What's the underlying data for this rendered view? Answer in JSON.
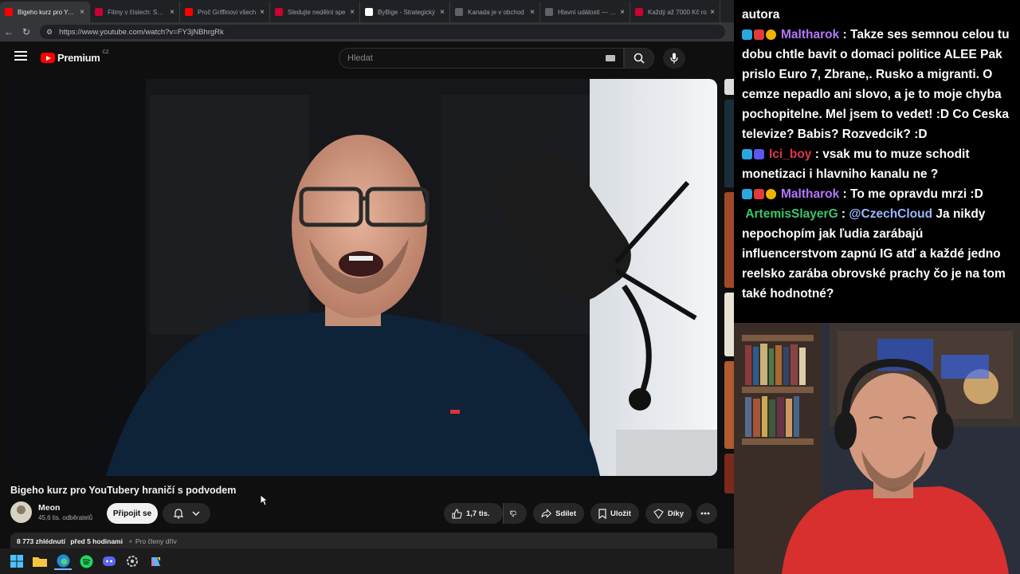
{
  "browser": {
    "tabs": [
      {
        "title": "Bigeho kurz pro YouT",
        "fav": "#ff0000",
        "active": true
      },
      {
        "title": "Filmy v číslech: SPIDE",
        "fav": "#cc0033",
        "active": false
      },
      {
        "title": "Proč Griffinovi všech",
        "fav": "#ff0000",
        "active": false
      },
      {
        "title": "Sledujte nedělní spe",
        "fav": "#cc0033",
        "active": false
      },
      {
        "title": "ByBige - Strategický",
        "fav": "#ffffff",
        "active": false
      },
      {
        "title": "Kanada je v obchod",
        "fav": "#5f6368",
        "active": false
      },
      {
        "title": "Hlavní události — ČT",
        "fav": "#5f6368",
        "active": false
      },
      {
        "title": "Každý až 7000 Kč ro",
        "fav": "#cc0033",
        "active": false
      }
    ],
    "url": "https://www.youtube.com/watch?v=FY3jNBhrgRk"
  },
  "youtube": {
    "logo_text": "Premium",
    "country": "CZ",
    "search_placeholder": "Hledat",
    "video_title": "Bigeho kurz pro YouTubery hraničí s podvodem",
    "channel_name": "Meon",
    "channel_subs": "45,6 tis. odběratelů",
    "join_label": "Připojit se",
    "like_count": "1,7 tis.",
    "share_label": "Sdílet",
    "save_label": "Uložit",
    "thanks_label": "Díky",
    "views": "8 773 zhlédnutí",
    "published": "před 5 hodinami",
    "members_label": "Pro členy dřív"
  },
  "chat": {
    "header": "autora",
    "messages": [
      {
        "user": "Maltharok",
        "text": "Takze ses semnou celou tu dobu chtle bavit o domaci politice ALEE Pak prislo Euro 7, Zbrane,. Rusko a migranti. O cemze nepadlo ani slovo, a je to moje chyba pochopitelne. Mel jsem to vedet! :D Co Ceska televize? Babis? Rozvedcik? :D"
      },
      {
        "user": "Ici_boy",
        "text": "vsak mu to muze schodit monetizaci i hlavniho kanalu ne ?"
      },
      {
        "user": "Maltharok",
        "text": "To me opravdu mrzi :D"
      },
      {
        "user": "ArtemisSlayerG",
        "mention": "@CzechCloud",
        "text": "Ja nikdy nepochopím jak ľudia zarábajú influencerstvom zapnú IG atď a každé jedno reelsko zarába obrovské prachy čo je na tom také hodnotné?"
      }
    ]
  },
  "colors": {
    "yt_red": "#ff0000",
    "bg": "#0f0f0f",
    "chat_purple": "#b476ff",
    "chat_red": "#e0344a",
    "chat_green": "#3ec46d"
  }
}
